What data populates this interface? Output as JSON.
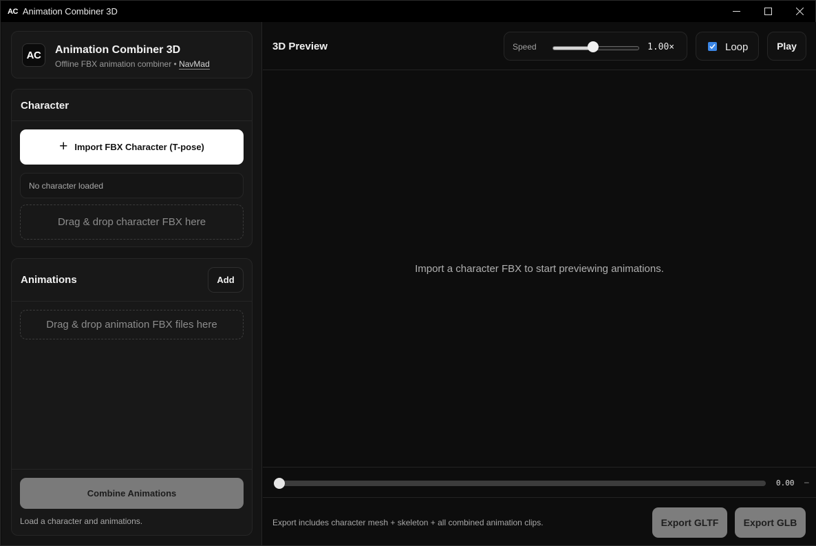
{
  "window": {
    "logo": "AC",
    "title": "Animation Combiner 3D"
  },
  "brand": {
    "logo": "AC",
    "title": "Animation Combiner 3D",
    "subtitle": "Offline FBX animation combiner •",
    "link": "NavMad"
  },
  "character": {
    "title": "Character",
    "import_label": "Import FBX Character (T-pose)",
    "status": "No character loaded",
    "drop_label": "Drag & drop character FBX here"
  },
  "animations": {
    "title": "Animations",
    "add_label": "Add",
    "drop_label": "Drag & drop animation FBX files here",
    "combine_label": "Combine Animations",
    "note": "Load a character and animations."
  },
  "preview": {
    "title": "3D Preview",
    "speed_label": "Speed",
    "speed_value": "1.00×",
    "speed_level": 0.47,
    "loop_label": "Loop",
    "loop_checked": true,
    "play_label": "Play",
    "empty_message": "Import a character FBX to start previewing animations.",
    "time_value": "0.00",
    "time_suffix": "–",
    "timeline_position": 0
  },
  "export": {
    "note": "Export includes character mesh + skeleton + all combined animation clips.",
    "gltf_label": "Export GLTF",
    "glb_label": "Export GLB"
  },
  "colors": {
    "accent_checkbox": "#3b86e6",
    "primary_button": "#ffffff",
    "disabled_button": "#7a7a7a"
  }
}
